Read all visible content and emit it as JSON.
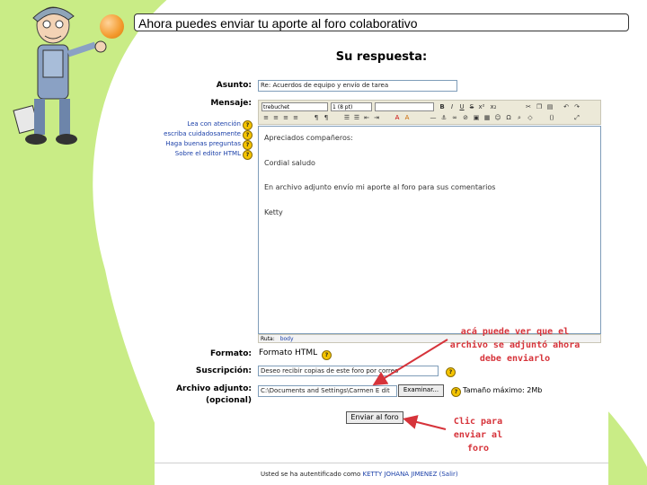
{
  "slide": {
    "title": "Ahora puedes enviar tu aporte al foro colaborativo",
    "colors": {
      "green": "#c9ec86",
      "orange": "#f39a2d",
      "annotation_red": "#d6333a",
      "hint_blue": "#1a3fa8"
    }
  },
  "form": {
    "heading": "Su respuesta:",
    "asunto_label": "Asunto:",
    "asunto_value": "Re: Acuerdos de equipo y envío de tarea",
    "mensaje_label": "Mensaje:",
    "hints": [
      "Lea con atención",
      "escriba cuidadosamente",
      "Haga buenas preguntas",
      "Sobre el editor HTML"
    ],
    "toolbar": {
      "font": "trebuchet",
      "size": "1 (8 pt)",
      "style": ""
    },
    "message_lines": [
      "Apreciados compañeros:",
      "Cordial saludo",
      "En archivo adjunto envío mi aporte al foro para sus comentarios",
      "Ketty"
    ],
    "path_prefix": "Ruta:",
    "path_value": "body",
    "formato_label": "Formato:",
    "formato_value": "Formato HTML",
    "suscripcion_label": "Suscripción:",
    "suscripcion_value": "Deseo recibir copias de este foro por correo",
    "adjunto_label": "Archivo adjunto:",
    "adjunto_optional": "(opcional)",
    "adjunto_value": "C:\\Documents and Settings\\Carmen E dit",
    "examinar_label": "Examinar...",
    "tamano_text": "Tamaño máximo: 2Mb",
    "submit_label": "Enviar al foro",
    "footer_prefix": "Usted se ha autentificado como",
    "footer_user": "KETTY JOHANA JIMENEZ",
    "footer_logout": "(Salir)"
  },
  "annotations": {
    "attachment_note": [
      "acá puede ver que el",
      "archivo se adjuntó ahora",
      "debe enviarlo"
    ],
    "send_note": [
      "Clic para",
      "enviar al",
      "foro"
    ]
  }
}
